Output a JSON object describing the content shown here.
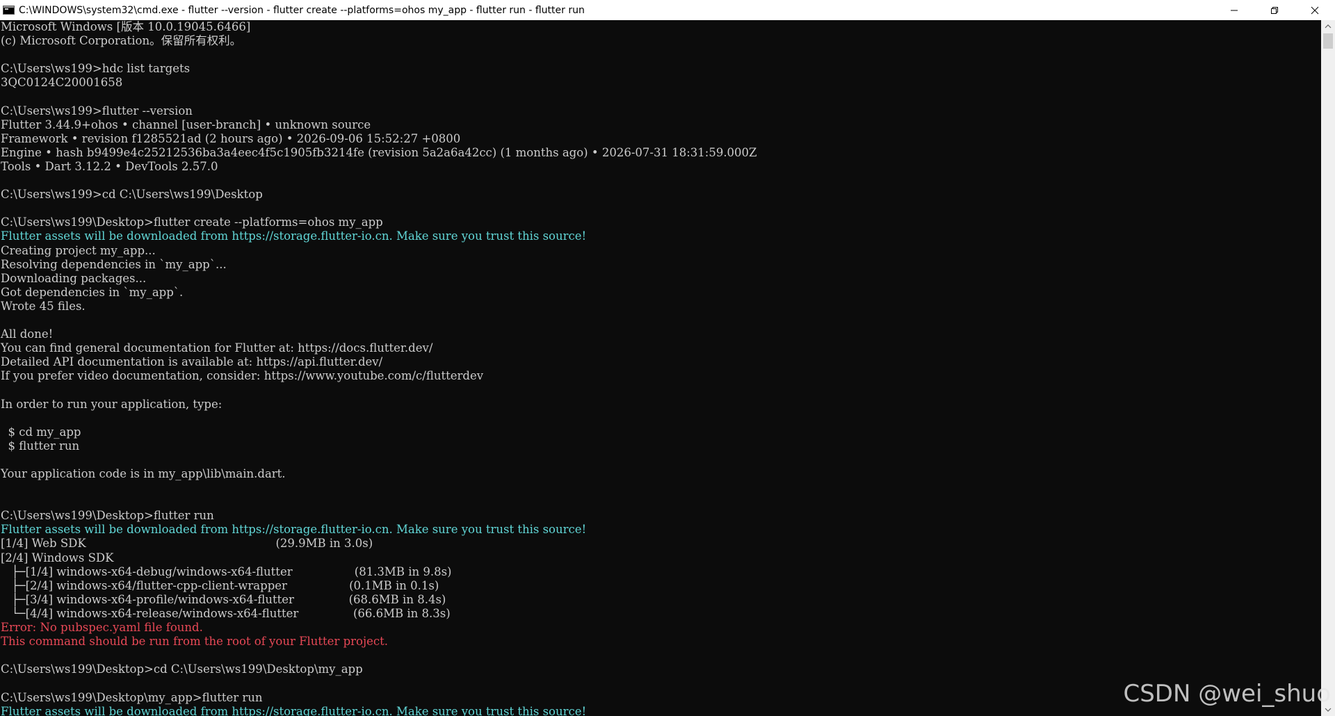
{
  "window": {
    "title": "C:\\WINDOWS\\system32\\cmd.exe - flutter  --version - flutter  create --platforms=ohos my_app - flutter  run - flutter  run"
  },
  "icons": {
    "app": "cmd-icon",
    "minimize": "minimize-icon",
    "restore": "restore-icon",
    "close": "close-icon",
    "scroll_up": "chevron-up-icon",
    "scroll_down": "chevron-down-icon"
  },
  "colors": {
    "background": "#0c0c0c",
    "text": "#cccccc",
    "info": "#61d6d6",
    "error": "#e74856"
  },
  "console": {
    "lines": [
      {
        "text": "Microsoft Windows [版本 10.0.19045.6466]",
        "color": "default"
      },
      {
        "text": "(c) Microsoft Corporation。保留所有权利。",
        "color": "default"
      },
      {
        "text": "",
        "color": "default"
      },
      {
        "text": "C:\\Users\\ws199>hdc list targets",
        "color": "default"
      },
      {
        "text": "3QC0124C20001658",
        "color": "default"
      },
      {
        "text": "",
        "color": "default"
      },
      {
        "text": "C:\\Users\\ws199>flutter --version",
        "color": "default"
      },
      {
        "text": "Flutter 3.44.9+ohos • channel [user-branch] • unknown source",
        "color": "default"
      },
      {
        "text": "Framework • revision f1285521ad (2 hours ago) • 2026-09-06 15:52:27 +0800",
        "color": "default"
      },
      {
        "text": "Engine • hash b9499e4c25212536ba3a4eec4f5c1905fb3214fe (revision 5a2a6a42cc) (1 months ago) • 2026-07-31 18:31:59.000Z",
        "color": "default"
      },
      {
        "text": "Tools • Dart 3.12.2 • DevTools 2.57.0",
        "color": "default"
      },
      {
        "text": "",
        "color": "default"
      },
      {
        "text": "C:\\Users\\ws199>cd C:\\Users\\ws199\\Desktop",
        "color": "default"
      },
      {
        "text": "",
        "color": "default"
      },
      {
        "text": "C:\\Users\\ws199\\Desktop>flutter create --platforms=ohos my_app",
        "color": "default"
      },
      {
        "text": "Flutter assets will be downloaded from https://storage.flutter-io.cn. Make sure you trust this source!",
        "color": "cyan"
      },
      {
        "text": "Creating project my_app...",
        "color": "default"
      },
      {
        "text": "Resolving dependencies in `my_app`...",
        "color": "default"
      },
      {
        "text": "Downloading packages...",
        "color": "default"
      },
      {
        "text": "Got dependencies in `my_app`.",
        "color": "default"
      },
      {
        "text": "Wrote 45 files.",
        "color": "default"
      },
      {
        "text": "",
        "color": "default"
      },
      {
        "text": "All done!",
        "color": "default"
      },
      {
        "text": "You can find general documentation for Flutter at: https://docs.flutter.dev/",
        "color": "default"
      },
      {
        "text": "Detailed API documentation is available at: https://api.flutter.dev/",
        "color": "default"
      },
      {
        "text": "If you prefer video documentation, consider: https://www.youtube.com/c/flutterdev",
        "color": "default"
      },
      {
        "text": "",
        "color": "default"
      },
      {
        "text": "In order to run your application, type:",
        "color": "default"
      },
      {
        "text": "",
        "color": "default"
      },
      {
        "text": "  $ cd my_app",
        "color": "default"
      },
      {
        "text": "  $ flutter run",
        "color": "default"
      },
      {
        "text": "",
        "color": "default"
      },
      {
        "text": "Your application code is in my_app\\lib\\main.dart.",
        "color": "default"
      },
      {
        "text": "",
        "color": "default"
      },
      {
        "text": "",
        "color": "default"
      },
      {
        "text": "C:\\Users\\ws199\\Desktop>flutter run",
        "color": "default"
      },
      {
        "text": "Flutter assets will be downloaded from https://storage.flutter-io.cn. Make sure you trust this source!",
        "color": "cyan"
      },
      {
        "text": "[1/4] Web SDK                                                    (29.9MB in 3.0s)",
        "color": "default"
      },
      {
        "text": "[2/4] Windows SDK",
        "color": "default"
      },
      {
        "text": "   ├─[1/4] windows-x64-debug/windows-x64-flutter                 (81.3MB in 9.8s)",
        "color": "default"
      },
      {
        "text": "   ├─[2/4] windows-x64/flutter-cpp-client-wrapper                 (0.1MB in 0.1s)",
        "color": "default"
      },
      {
        "text": "   ├─[3/4] windows-x64-profile/windows-x64-flutter               (68.6MB in 8.4s)",
        "color": "default"
      },
      {
        "text": "   └─[4/4] windows-x64-release/windows-x64-flutter               (66.6MB in 8.3s)",
        "color": "default"
      },
      {
        "text": "Error: No pubspec.yaml file found.",
        "color": "red"
      },
      {
        "text": "This command should be run from the root of your Flutter project.",
        "color": "red"
      },
      {
        "text": "",
        "color": "default"
      },
      {
        "text": "C:\\Users\\ws199\\Desktop>cd C:\\Users\\ws199\\Desktop\\my_app",
        "color": "default"
      },
      {
        "text": "",
        "color": "default"
      },
      {
        "text": "C:\\Users\\ws199\\Desktop\\my_app>flutter run",
        "color": "default"
      },
      {
        "text": "Flutter assets will be downloaded from https://storage.flutter-io.cn. Make sure you trust this source!",
        "color": "cyan"
      }
    ]
  },
  "watermark": {
    "text": "CSDN @wei_shuo"
  }
}
